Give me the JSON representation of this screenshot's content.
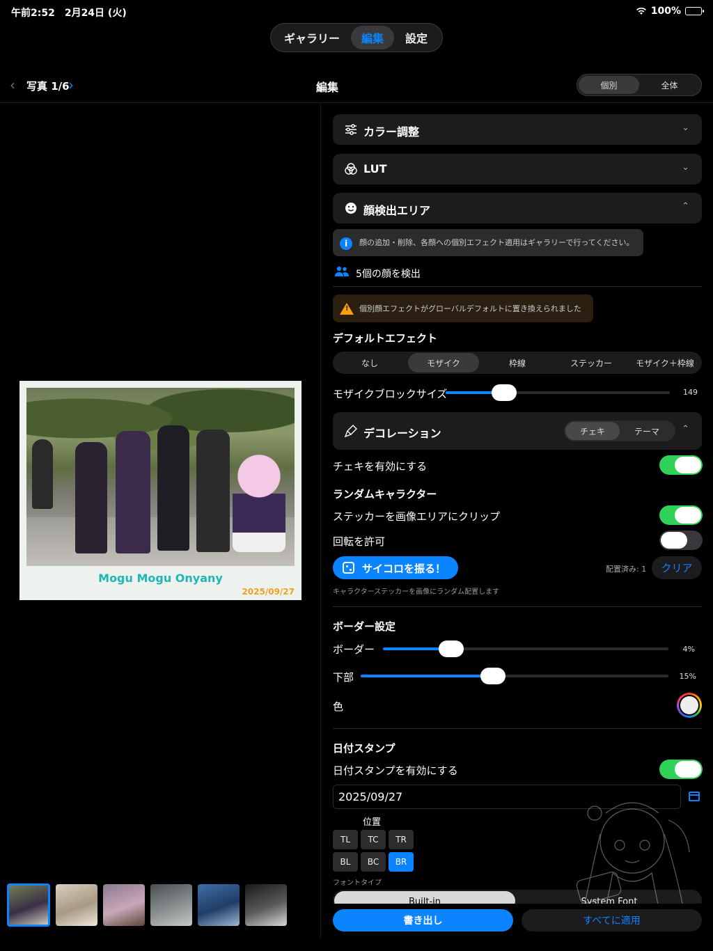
{
  "status_bar": {
    "time": "午前2:52　2月24日 (火)",
    "battery": "100%"
  },
  "top_tabs": [
    {
      "label": "ギャラリー"
    },
    {
      "label": "編集"
    },
    {
      "label": "設定"
    }
  ],
  "header": {
    "photo_count": "写真 1/6",
    "title": "編集",
    "scope_options": [
      "個別",
      "全体"
    ],
    "scope_selected": "個別"
  },
  "preview": {
    "caption_title": "Mogu Mogu Onyany",
    "caption_date": "2025/09/27"
  },
  "sections": {
    "color": {
      "label": "カラー調整"
    },
    "lut": {
      "label": "LUT"
    },
    "face": {
      "label": "顔検出エリア"
    }
  },
  "face_area": {
    "info_text": "顔の追加・削除、各顔への個別エフェクト適用はギャラリーで行ってください。",
    "faces_detected": "5個の顔を検出",
    "warning_text": "個別顔エフェクトがグローバルデフォルトに置き換えられました",
    "default_effect_label": "デフォルトエフェクト",
    "effects": [
      "なし",
      "モザイク",
      "枠線",
      "ステッカー",
      "モザイク＋枠線"
    ],
    "effect_selected": "モザイク",
    "mosaic_label": "モザイクブロックサイズ",
    "mosaic_value": 149,
    "mosaic_value_text": "149",
    "mosaic_fraction": 0.26
  },
  "decoration": {
    "label": "デコレーション",
    "modes": [
      "チェキ",
      "テーマ"
    ],
    "mode_selected": "チェキ",
    "cheki_enable_label": "チェキを有効にする",
    "cheki_enabled": true,
    "random_char_label": "ランダムキャラクター",
    "clip_label": "ステッカーを画像エリアにクリップ",
    "clip_enabled": true,
    "rotate_label": "回転を許可",
    "rotate_enabled": false,
    "dice_label": "サイコロを振る！",
    "placed_text": "配置済み: 1",
    "clear_label": "クリア",
    "hint": "キャラクターステッカーを画像にランダム配置します"
  },
  "border": {
    "title": "ボーダー設定",
    "border_label": "ボーダー",
    "border_value_text": "4%",
    "border_fraction": 0.24,
    "bottom_label": "下部",
    "bottom_value_text": "15%",
    "bottom_fraction": 0.43,
    "color_label": "色",
    "color_value": "#eeeeec"
  },
  "date_stamp": {
    "title": "日付スタンプ",
    "enable_label": "日付スタンプを有効にする",
    "enabled": true,
    "date_value": "2025/09/27",
    "position_label": "位置",
    "positions": [
      "TL",
      "TC",
      "TR",
      "BL",
      "BC",
      "BR"
    ],
    "position_selected": "BR",
    "font_type_label": "フォントタイプ",
    "font_types": [
      "Built-in",
      "System Font"
    ],
    "font_type_selected": "Built-in"
  },
  "actions": {
    "export_label": "書き出し",
    "apply_all_label": "すべてに適用"
  },
  "thumbnails": [
    {
      "name": "thumb-1",
      "colors": [
        "#6f7d55",
        "#3a2f45",
        "#c9c6bd"
      ]
    },
    {
      "name": "thumb-2",
      "colors": [
        "#d9cfc0",
        "#a89a84",
        "#efe8dc"
      ]
    },
    {
      "name": "thumb-3",
      "colors": [
        "#8b7b8f",
        "#c9a7b8",
        "#5a4a3a"
      ]
    },
    {
      "name": "thumb-4",
      "colors": [
        "#4a4f52",
        "#8a8f90",
        "#c6c9c6"
      ]
    },
    {
      "name": "thumb-5",
      "colors": [
        "#3f6fa8",
        "#1f3d66",
        "#9fb8d6"
      ]
    },
    {
      "name": "thumb-6",
      "colors": [
        "#1a1a1a",
        "#5a5a5a",
        "#d8d8d8"
      ]
    }
  ],
  "colors": {
    "accent": "#0a84ff",
    "toggle_on": "#30d158",
    "warning": "#ff9f0a"
  }
}
